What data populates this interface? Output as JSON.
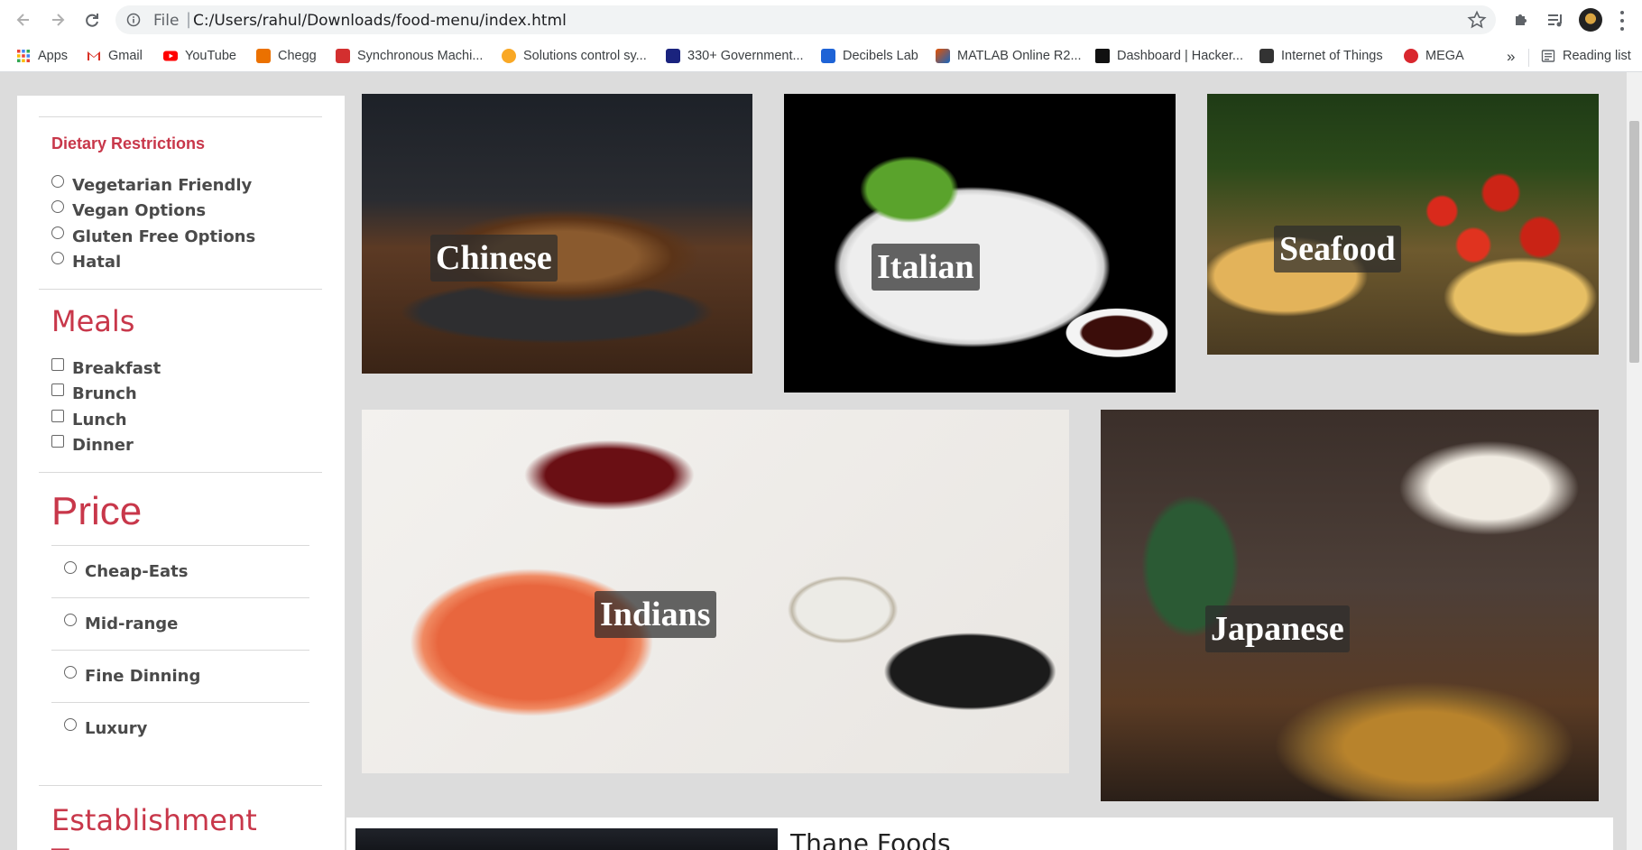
{
  "browser": {
    "scheme_label": "File",
    "url": "C:/Users/rahul/Downloads/food-menu/index.html"
  },
  "bookmarks": [
    {
      "label": "Apps",
      "icon": "apps-grid-icon",
      "color": "#ea4335"
    },
    {
      "label": "Gmail",
      "icon": "gmail-icon",
      "color": "#d93025"
    },
    {
      "label": "YouTube",
      "icon": "youtube-icon",
      "color": "#ff0000"
    },
    {
      "label": "Chegg",
      "icon": "chegg-icon",
      "color": "#eb7100"
    },
    {
      "label": "Synchronous Machi...",
      "icon": "site-icon",
      "color": "#d32f2f"
    },
    {
      "label": "Solutions control sy...",
      "icon": "site-icon",
      "color": "#f9a825"
    },
    {
      "label": "330+ Government...",
      "icon": "site-icon",
      "color": "#1a237e"
    },
    {
      "label": "Decibels Lab",
      "icon": "docs-icon",
      "color": "#1e63d6"
    },
    {
      "label": "MATLAB Online R2...",
      "icon": "matlab-icon",
      "color": "#e65100"
    },
    {
      "label": "Dashboard | Hacker...",
      "icon": "hackerrank-icon",
      "color": "#111111"
    },
    {
      "label": "Internet of Things",
      "icon": "site-icon",
      "color": "#333333"
    },
    {
      "label": "MEGA",
      "icon": "mega-icon",
      "color": "#d9272e"
    }
  ],
  "bookmarks_overflow": "»",
  "reading_list": "Reading list",
  "sidebar": {
    "dietary": {
      "title": "Dietary Restrictions",
      "options": [
        "Vegetarian Friendly",
        "Vegan Options",
        "Gluten Free Options",
        "Hatal"
      ]
    },
    "meals": {
      "title": "Meals",
      "options": [
        "Breakfast",
        "Brunch",
        "Lunch",
        "Dinner"
      ]
    },
    "price": {
      "title": "Price",
      "options": [
        "Cheap-Eats",
        "Mid-range",
        "Fine Dinning",
        "Luxury"
      ]
    },
    "establishment": {
      "title": "Establishment Type"
    }
  },
  "cards": [
    {
      "label": "Chinese"
    },
    {
      "label": "Italian"
    },
    {
      "label": "Seafood"
    },
    {
      "label": "Indians"
    },
    {
      "label": "Japanese"
    }
  ],
  "below_fold_heading": "Thane Foods",
  "colors": {
    "accent": "#c8374a",
    "page_bg": "#dcdcdc"
  }
}
